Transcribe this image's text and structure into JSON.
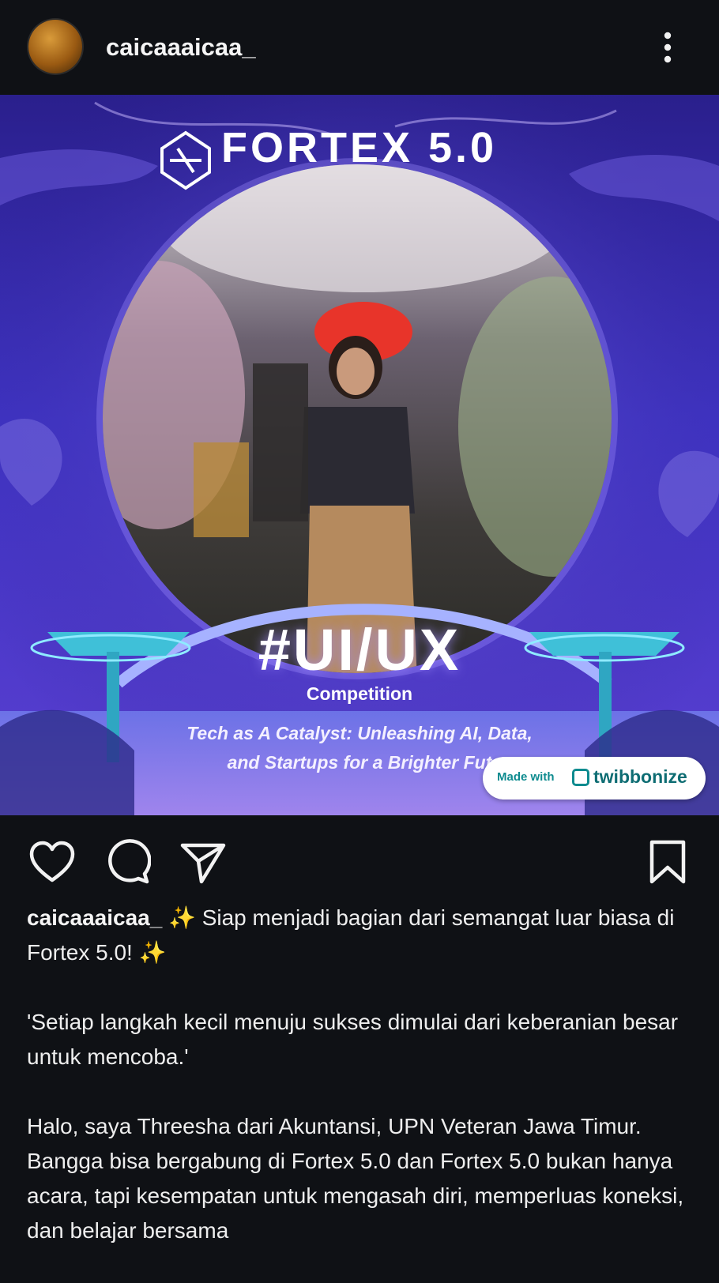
{
  "post": {
    "username": "caicaaaicaa_",
    "image": {
      "title": "FORTEX 5.0",
      "hashtag": "#UI/UX",
      "subtitle": "Competition",
      "tagline_line1": "Tech as A Catalyst: Unleashing AI, Data,",
      "tagline_line2": "and Startups for a Brighter Fut",
      "badge_made_with": "Made with",
      "badge_brand": "twibbonize"
    },
    "actions": {
      "like_icon": "heart-icon",
      "comment_icon": "comment-icon",
      "share_icon": "send-icon",
      "save_icon": "bookmark-icon"
    },
    "caption": {
      "username": "caicaaaicaa_",
      "line1": " ✨ Siap menjadi bagian dari semangat luar biasa di Fortex 5.0! ✨",
      "paragraph2": "'Setiap langkah kecil menuju sukses dimulai dari keberanian besar untuk mencoba.'",
      "paragraph3": "Halo, saya Threesha dari Akuntansi, UPN Veteran Jawa Timur. Bangga bisa bergabung di Fortex 5.0 dan Fortex 5.0 bukan hanya acara, tapi kesempatan untuk mengasah diri, memperluas koneksi, dan belajar bersama"
    }
  },
  "colors": {
    "background": "#0f1115",
    "poster_primary": "#3a2bb8",
    "poster_accent": "#8fd8ff",
    "badge_teal": "#0e8b8f"
  }
}
